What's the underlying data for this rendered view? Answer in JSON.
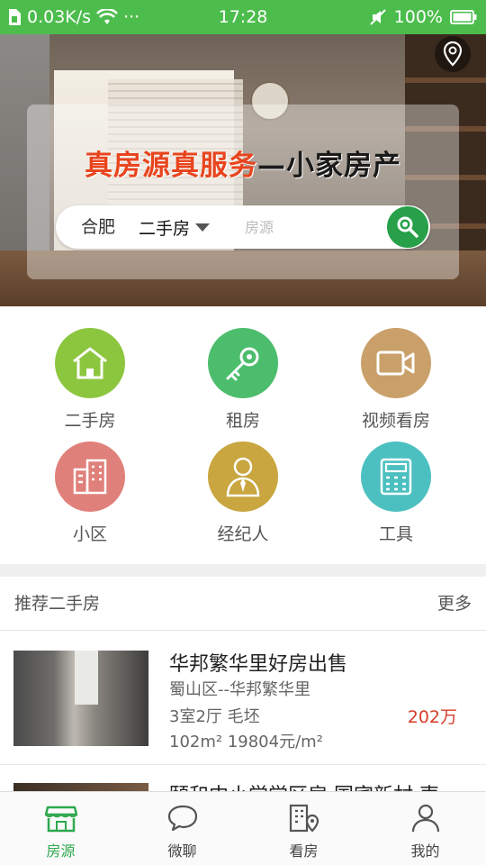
{
  "status_bar": {
    "data_speed": "0.03K/s",
    "dots": "···",
    "time": "17:28",
    "battery": "100%"
  },
  "banner": {
    "slogan_main": "真房源真服务",
    "slogan_brand": "—小家房产"
  },
  "search": {
    "city": "合肥",
    "type": "二手房",
    "placeholder": "房源"
  },
  "categories": [
    {
      "label": "二手房",
      "color": "#8cc63f",
      "icon": "house-icon"
    },
    {
      "label": "租房",
      "color": "#4cbd6c",
      "icon": "key-icon"
    },
    {
      "label": "视频看房",
      "color": "#c9a06a",
      "icon": "video-camera-icon"
    },
    {
      "label": "小区",
      "color": "#e0807a",
      "icon": "building-icon"
    },
    {
      "label": "经纪人",
      "color": "#c9a640",
      "icon": "agent-icon"
    },
    {
      "label": "工具",
      "color": "#4cc0c0",
      "icon": "calculator-icon"
    }
  ],
  "recommend": {
    "title": "推荐二手房",
    "more": "更多",
    "listings": [
      {
        "title": "华邦繁华里好房出售",
        "area": "蜀山区--华邦繁华里",
        "layout": "3室2厅 毛坯",
        "size": "102m² 19804元/m²",
        "price": "202万"
      },
      {
        "title": "颐和中小学学区房 国宾新村 声"
      }
    ]
  },
  "tabs": [
    {
      "label": "房源",
      "icon": "storefront-icon",
      "active": true
    },
    {
      "label": "微聊",
      "icon": "chat-icon",
      "active": false
    },
    {
      "label": "看房",
      "icon": "map-pin-building-icon",
      "active": false
    },
    {
      "label": "我的",
      "icon": "user-icon",
      "active": false
    }
  ],
  "colors": {
    "accent": "#2ea84e",
    "status_bar": "#4cbd4c",
    "price": "#d53d2a",
    "slogan_red": "#e8451e"
  }
}
